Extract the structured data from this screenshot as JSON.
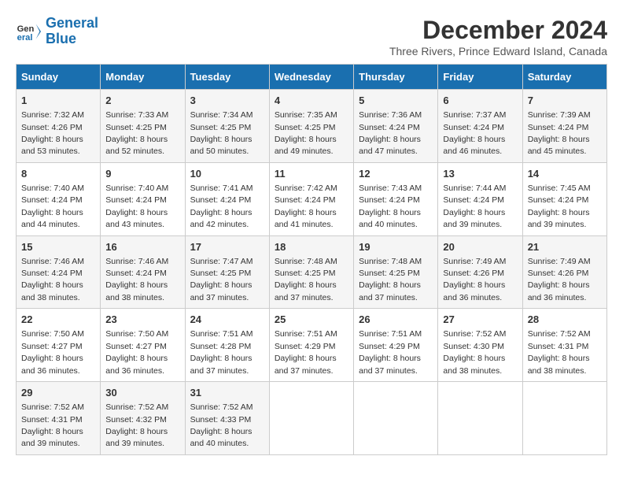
{
  "logo": {
    "text_general": "General",
    "text_blue": "Blue"
  },
  "header": {
    "month": "December 2024",
    "location": "Three Rivers, Prince Edward Island, Canada"
  },
  "days_of_week": [
    "Sunday",
    "Monday",
    "Tuesday",
    "Wednesday",
    "Thursday",
    "Friday",
    "Saturday"
  ],
  "weeks": [
    [
      {
        "day": "1",
        "sunrise": "7:32 AM",
        "sunset": "4:26 PM",
        "daylight": "8 hours and 53 minutes."
      },
      {
        "day": "2",
        "sunrise": "7:33 AM",
        "sunset": "4:25 PM",
        "daylight": "8 hours and 52 minutes."
      },
      {
        "day": "3",
        "sunrise": "7:34 AM",
        "sunset": "4:25 PM",
        "daylight": "8 hours and 50 minutes."
      },
      {
        "day": "4",
        "sunrise": "7:35 AM",
        "sunset": "4:25 PM",
        "daylight": "8 hours and 49 minutes."
      },
      {
        "day": "5",
        "sunrise": "7:36 AM",
        "sunset": "4:24 PM",
        "daylight": "8 hours and 47 minutes."
      },
      {
        "day": "6",
        "sunrise": "7:37 AM",
        "sunset": "4:24 PM",
        "daylight": "8 hours and 46 minutes."
      },
      {
        "day": "7",
        "sunrise": "7:39 AM",
        "sunset": "4:24 PM",
        "daylight": "8 hours and 45 minutes."
      }
    ],
    [
      {
        "day": "8",
        "sunrise": "7:40 AM",
        "sunset": "4:24 PM",
        "daylight": "8 hours and 44 minutes."
      },
      {
        "day": "9",
        "sunrise": "7:40 AM",
        "sunset": "4:24 PM",
        "daylight": "8 hours and 43 minutes."
      },
      {
        "day": "10",
        "sunrise": "7:41 AM",
        "sunset": "4:24 PM",
        "daylight": "8 hours and 42 minutes."
      },
      {
        "day": "11",
        "sunrise": "7:42 AM",
        "sunset": "4:24 PM",
        "daylight": "8 hours and 41 minutes."
      },
      {
        "day": "12",
        "sunrise": "7:43 AM",
        "sunset": "4:24 PM",
        "daylight": "8 hours and 40 minutes."
      },
      {
        "day": "13",
        "sunrise": "7:44 AM",
        "sunset": "4:24 PM",
        "daylight": "8 hours and 39 minutes."
      },
      {
        "day": "14",
        "sunrise": "7:45 AM",
        "sunset": "4:24 PM",
        "daylight": "8 hours and 39 minutes."
      }
    ],
    [
      {
        "day": "15",
        "sunrise": "7:46 AM",
        "sunset": "4:24 PM",
        "daylight": "8 hours and 38 minutes."
      },
      {
        "day": "16",
        "sunrise": "7:46 AM",
        "sunset": "4:24 PM",
        "daylight": "8 hours and 38 minutes."
      },
      {
        "day": "17",
        "sunrise": "7:47 AM",
        "sunset": "4:25 PM",
        "daylight": "8 hours and 37 minutes."
      },
      {
        "day": "18",
        "sunrise": "7:48 AM",
        "sunset": "4:25 PM",
        "daylight": "8 hours and 37 minutes."
      },
      {
        "day": "19",
        "sunrise": "7:48 AM",
        "sunset": "4:25 PM",
        "daylight": "8 hours and 37 minutes."
      },
      {
        "day": "20",
        "sunrise": "7:49 AM",
        "sunset": "4:26 PM",
        "daylight": "8 hours and 36 minutes."
      },
      {
        "day": "21",
        "sunrise": "7:49 AM",
        "sunset": "4:26 PM",
        "daylight": "8 hours and 36 minutes."
      }
    ],
    [
      {
        "day": "22",
        "sunrise": "7:50 AM",
        "sunset": "4:27 PM",
        "daylight": "8 hours and 36 minutes."
      },
      {
        "day": "23",
        "sunrise": "7:50 AM",
        "sunset": "4:27 PM",
        "daylight": "8 hours and 36 minutes."
      },
      {
        "day": "24",
        "sunrise": "7:51 AM",
        "sunset": "4:28 PM",
        "daylight": "8 hours and 37 minutes."
      },
      {
        "day": "25",
        "sunrise": "7:51 AM",
        "sunset": "4:29 PM",
        "daylight": "8 hours and 37 minutes."
      },
      {
        "day": "26",
        "sunrise": "7:51 AM",
        "sunset": "4:29 PM",
        "daylight": "8 hours and 37 minutes."
      },
      {
        "day": "27",
        "sunrise": "7:52 AM",
        "sunset": "4:30 PM",
        "daylight": "8 hours and 38 minutes."
      },
      {
        "day": "28",
        "sunrise": "7:52 AM",
        "sunset": "4:31 PM",
        "daylight": "8 hours and 38 minutes."
      }
    ],
    [
      {
        "day": "29",
        "sunrise": "7:52 AM",
        "sunset": "4:31 PM",
        "daylight": "8 hours and 39 minutes."
      },
      {
        "day": "30",
        "sunrise": "7:52 AM",
        "sunset": "4:32 PM",
        "daylight": "8 hours and 39 minutes."
      },
      {
        "day": "31",
        "sunrise": "7:52 AM",
        "sunset": "4:33 PM",
        "daylight": "8 hours and 40 minutes."
      },
      null,
      null,
      null,
      null
    ]
  ]
}
